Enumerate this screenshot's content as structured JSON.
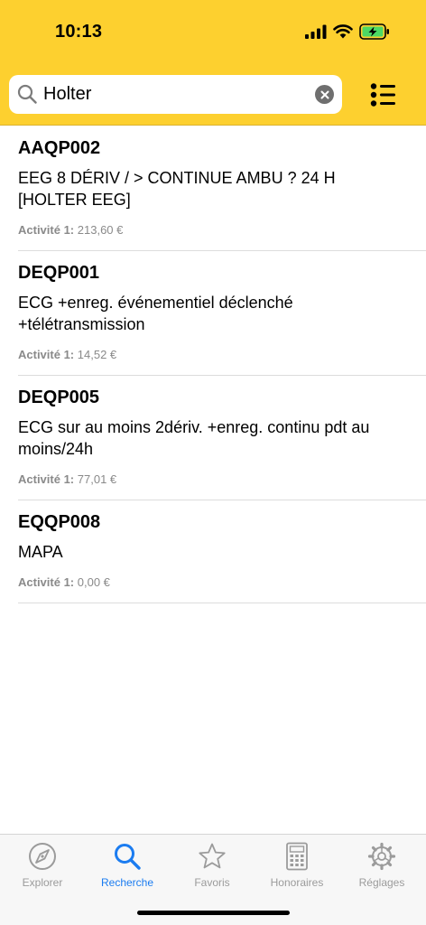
{
  "status_bar": {
    "time": "10:13"
  },
  "search": {
    "value": "Holter",
    "placeholder": ""
  },
  "results": [
    {
      "code": "AAQP002",
      "label": "EEG 8 DÉRIV / > CONTINUE AMBU ? 24 H [HOLTER EEG]",
      "activity_label": "Activité 1:",
      "price": "213,60 €"
    },
    {
      "code": "DEQP001",
      "label": "ECG +enreg. événementiel déclenché +télétransmission",
      "activity_label": "Activité 1:",
      "price": "14,52 €"
    },
    {
      "code": "DEQP005",
      "label": "ECG sur au moins 2dériv. +enreg. continu pdt au moins/24h",
      "activity_label": "Activité 1:",
      "price": "77,01 €"
    },
    {
      "code": "EQQP008",
      "label": "MAPA",
      "activity_label": "Activité 1:",
      "price": "0,00 €"
    }
  ],
  "tabs": [
    {
      "label": "Explorer",
      "icon": "compass-icon",
      "active": false
    },
    {
      "label": "Recherche",
      "icon": "search-icon",
      "active": true
    },
    {
      "label": "Favoris",
      "icon": "star-icon",
      "active": false
    },
    {
      "label": "Honoraires",
      "icon": "calculator-icon",
      "active": false
    },
    {
      "label": "Réglages",
      "icon": "gear-icon",
      "active": false
    }
  ],
  "colors": {
    "header": "#fdd02f",
    "accent": "#1b7cf0",
    "inactive": "#9b9b9b",
    "battery": "#4cd964"
  }
}
